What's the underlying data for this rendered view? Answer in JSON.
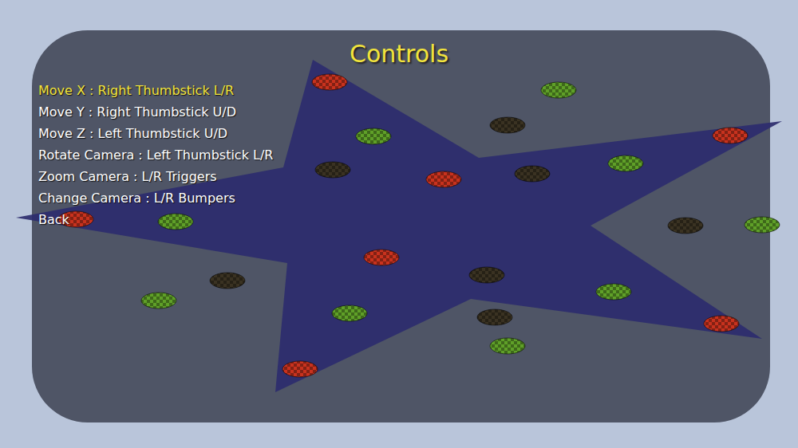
{
  "screen": {
    "title": "Controls"
  },
  "menu": [
    {
      "label": "Move X : Right Thumbstick L/R",
      "selected": true
    },
    {
      "label": "Move Y : Right Thumbstick U/D",
      "selected": false
    },
    {
      "label": "Move Z : Left Thumbstick U/D",
      "selected": false
    },
    {
      "label": "Rotate Camera : Left Thumbstick L/R",
      "selected": false
    },
    {
      "label": "Zoom Camera : L/R Triggers",
      "selected": false
    },
    {
      "label": "Change Camera : L/R Bumpers",
      "selected": false
    },
    {
      "label": "Back",
      "selected": false
    }
  ],
  "balls": [
    {
      "color": "#c8321e"
    },
    {
      "color": "#c8321e"
    },
    {
      "color": "#c8321e"
    },
    {
      "color": "#c8321e"
    },
    {
      "color": "#c8321e"
    },
    {
      "color": "#c8321e"
    },
    {
      "color": "#c8321e"
    },
    {
      "color": "#5fa028"
    },
    {
      "color": "#5fa028"
    },
    {
      "color": "#5fa028"
    },
    {
      "color": "#5fa028"
    },
    {
      "color": "#5fa028"
    },
    {
      "color": "#5fa028"
    },
    {
      "color": "#5fa028"
    },
    {
      "color": "#5fa028"
    },
    {
      "color": "#5fa028"
    },
    {
      "color": "#3a3222"
    },
    {
      "color": "#3a3222"
    },
    {
      "color": "#3a3222"
    },
    {
      "color": "#3a3222"
    },
    {
      "color": "#3a3222"
    },
    {
      "color": "#3a3222"
    },
    {
      "color": "#3a3222"
    }
  ]
}
